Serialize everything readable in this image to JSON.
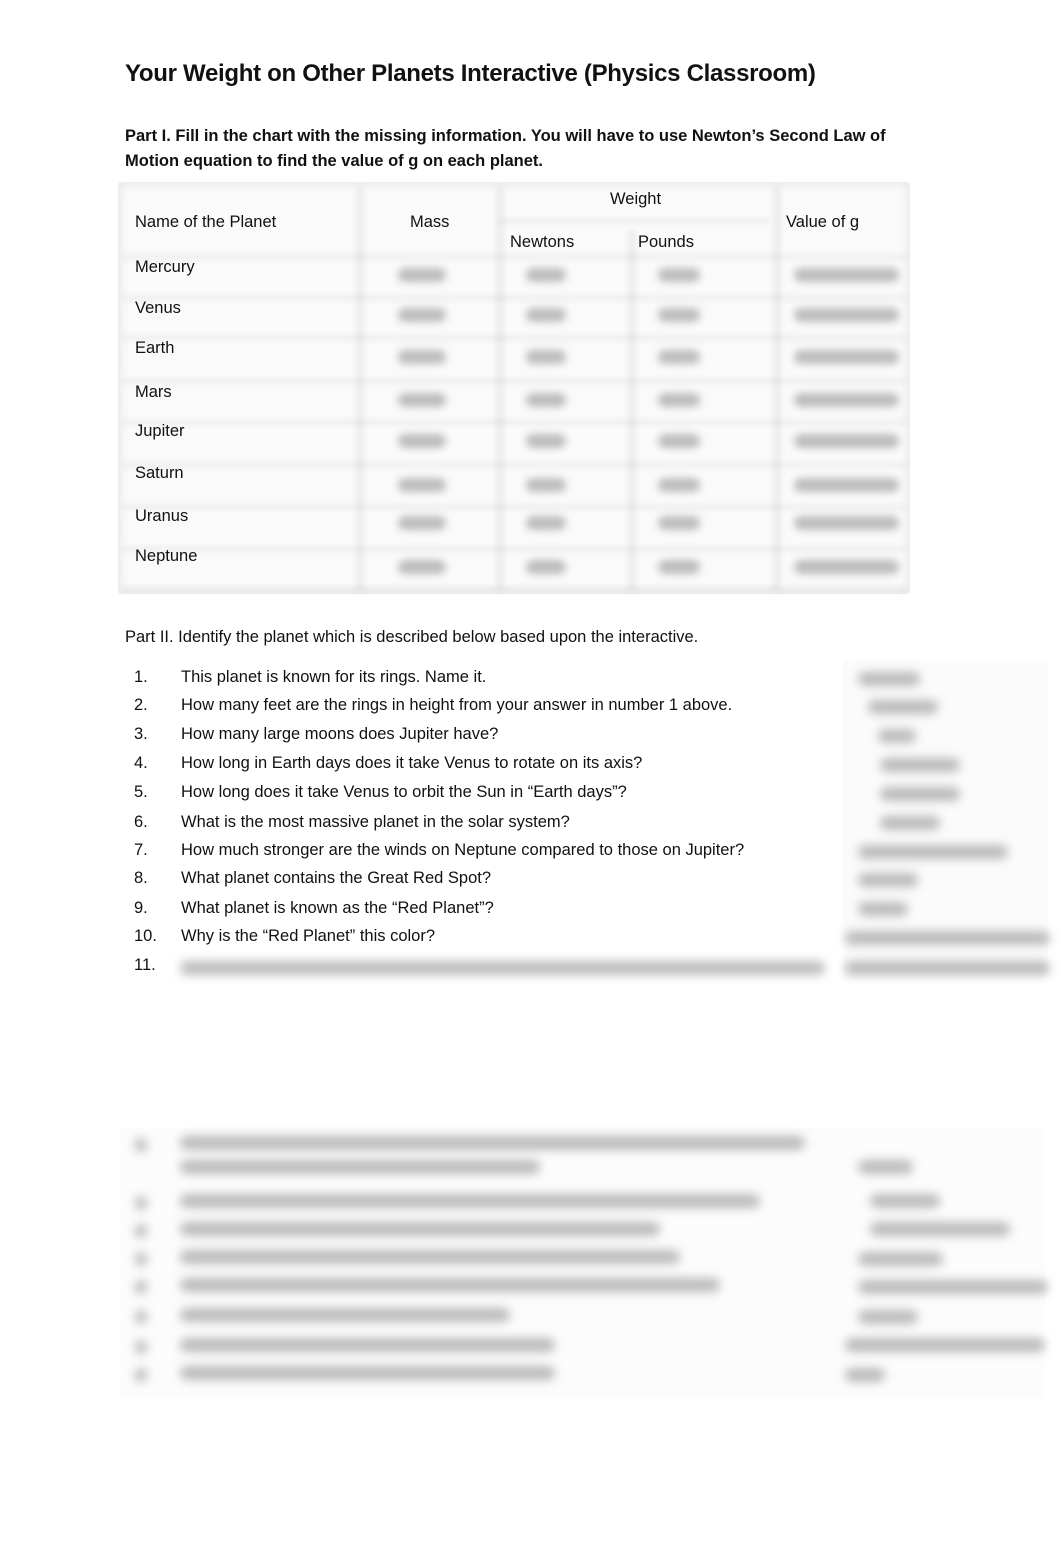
{
  "document": {
    "title": "Your Weight on Other Planets Interactive (Physics Classroom)",
    "part1": {
      "instructions": "Part I.  Fill in the chart with the missing information.  You will have to use Newton’s Second Law of Motion equation to find the value of g on each planet.",
      "table": {
        "headers": {
          "planet": "Name of the Planet",
          "mass": "Mass",
          "weight": "Weight",
          "newtons": "Newtons",
          "pounds": "Pounds",
          "g": "Value of g"
        },
        "rows": [
          {
            "planet": "Mercury"
          },
          {
            "planet": "Venus"
          },
          {
            "planet": "Earth"
          },
          {
            "planet": "Mars"
          },
          {
            "planet": "Jupiter"
          },
          {
            "planet": "Saturn"
          },
          {
            "planet": "Uranus"
          },
          {
            "planet": "Neptune"
          }
        ],
        "cell_values_obscured": true
      }
    },
    "part2": {
      "instructions": "Part II.  Identify the planet which is described below based upon the interactive.",
      "questions": [
        {
          "num": "1.",
          "text": "This planet is known for its rings.  Name it."
        },
        {
          "num": "2.",
          "text": "How many feet are the rings in height from your answer in number 1 above."
        },
        {
          "num": "3.",
          "text": "How many large moons does Jupiter have?"
        },
        {
          "num": "4.",
          "text": "How long in Earth days does it take Venus to rotate on its axis?"
        },
        {
          "num": "5.",
          "text": "How long does it take Venus to orbit the Sun in “Earth days”?"
        },
        {
          "num": "6.",
          "text": "What is the most massive planet in the solar system?"
        },
        {
          "num": "7.",
          "text": "How much stronger are the winds on Neptune compared to those on Jupiter?"
        },
        {
          "num": "8.",
          "text": "What planet contains the Great Red Spot?"
        },
        {
          "num": "9.",
          "text": "What planet is known as the “Red Planet”?"
        },
        {
          "num": "10.",
          "text": "Why is the “Red Planet” this color?"
        },
        {
          "num": "11.",
          "text": ""
        }
      ],
      "answers_obscured": true,
      "lower_section_obscured": true
    }
  }
}
